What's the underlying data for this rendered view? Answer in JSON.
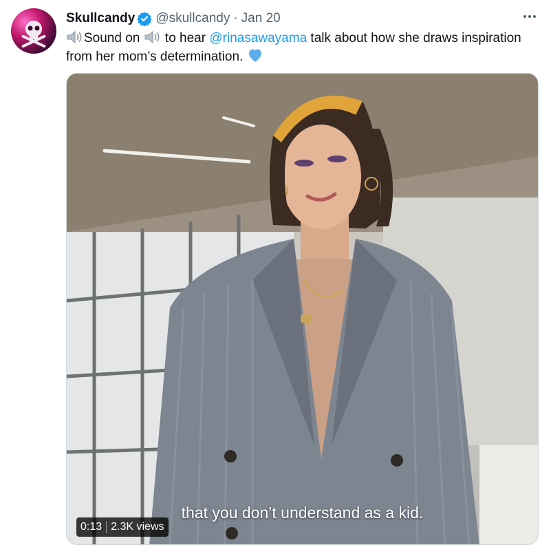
{
  "tweet": {
    "display_name": "Skullcandy",
    "handle": "@skullcandy",
    "separator": "·",
    "date": "Jan 20",
    "text_part1": "Sound on",
    "text_part2": " to hear ",
    "mention": "@rinasawayama",
    "text_part3": "  talk about how she draws inspiration from her mom’s determination.",
    "icons": {
      "sound_on": "speaker-icon",
      "heart": "blue-heart-icon",
      "verified": "verified-badge-icon",
      "more": "more-options-icon"
    },
    "colors": {
      "link": "#1d9bf0",
      "verified": "#1d9bf0",
      "heart": "#5dadec"
    }
  },
  "media": {
    "caption": "that you don’t understand as a kid.",
    "duration": "0:13",
    "views": "2.3K views"
  }
}
